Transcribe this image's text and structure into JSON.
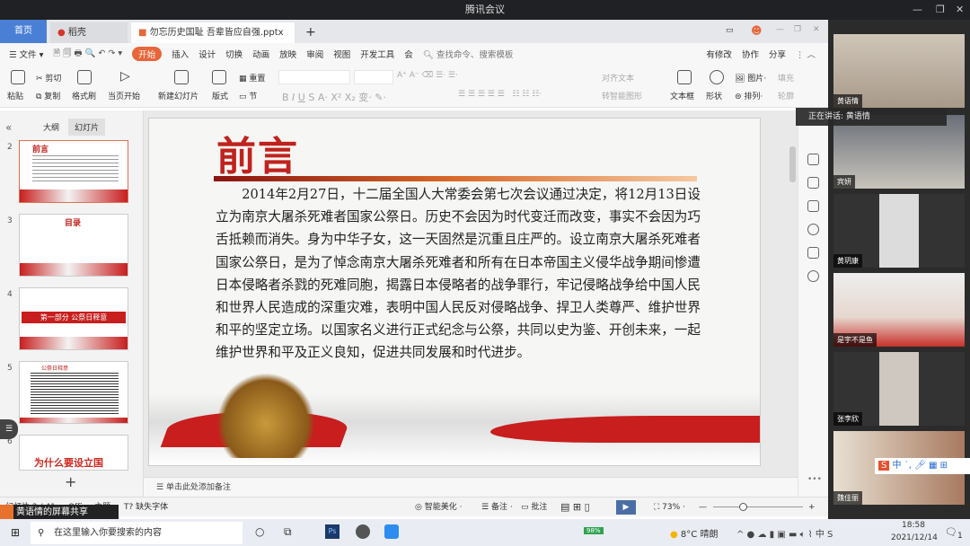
{
  "window": {
    "title": "腾讯会议"
  },
  "tabs": [
    {
      "label": "首页"
    },
    {
      "label": "稻壳"
    },
    {
      "label": "勿忘历史国耻 吾辈皆应自强.pptx"
    }
  ],
  "menu": {
    "file": "文件",
    "items": [
      "开始",
      "插入",
      "设计",
      "切换",
      "动画",
      "放映",
      "审阅",
      "视图",
      "开发工具",
      "会"
    ],
    "active": "开始",
    "search_placeholder": "查找命令、搜索模板",
    "right": [
      "有修改",
      "协作",
      "分享"
    ]
  },
  "ribbon": {
    "paste": "粘贴",
    "cut": "剪切",
    "copy": "复制",
    "format_painter": "格式刷",
    "play_from_current": "当页开始",
    "new_slide": "新建幻灯片",
    "layout": "版式",
    "section": "节",
    "reset": "重置",
    "align_text": "对齐文本",
    "smart_shape": "转智能图形",
    "textbox": "文本框",
    "shape": "形状",
    "picture": "图片",
    "arrange": "排列",
    "fill": "填充",
    "outline": "轮廓"
  },
  "left_panel": {
    "tabs": [
      "大纲",
      "幻灯片"
    ],
    "active_tab": "幻灯片",
    "slides": [
      {
        "num": "2",
        "title": "前言"
      },
      {
        "num": "3",
        "title": "目录"
      },
      {
        "num": "4",
        "title": "第一部分 公祭日释意"
      },
      {
        "num": "5",
        "title": "公祭日释意"
      },
      {
        "num": "6",
        "title": "为什么要设立国"
      }
    ],
    "add": "+"
  },
  "slide": {
    "title": "前言",
    "body": "2014年2月27日，十二届全国人大常委会第七次会议通过决定，将12月13日设立为南京大屠杀死难者国家公祭日。历史不会因为时代变迁而改变，事实不会因为巧舌抵赖而消失。身为中华子女，这一天固然是沉重且庄严的。设立南京大屠杀死难者国家公祭日，是为了悼念南京大屠杀死难者和所有在日本帝国主义侵华战争期间惨遭日本侵略者杀戮的死难同胞，揭露日本侵略者的战争罪行，牢记侵略战争给中国人民和世界人民造成的深重灾难，表明中国人民反对侵略战争、捍卫人类尊严、维护世界和平的坚定立场。以国家名义进行正式纪念与公祭，共同以史为鉴、开创未来，一起维护世界和平及正义良知，促进共同发展和时代进步。"
  },
  "notes_placeholder": "单击此处添加备注",
  "status": {
    "slide_count": "幻灯片 2 / 41",
    "theme": "Office 主题",
    "missing_font": "缺失字体",
    "beautify": "智能美化",
    "notes": "备注",
    "comment": "批注",
    "zoom": "73%",
    "zoom_level": 0.73
  },
  "screen_share": "黄语情的屏幕共享",
  "meeting": {
    "speaking": "正在讲话: 黄语情",
    "participants": [
      "黄语情",
      "宾妍",
      "黄玥康",
      "是宇不是鱼",
      "张李欣",
      "魏佳丽"
    ]
  },
  "ime": {
    "label": "中"
  },
  "taskbar": {
    "search_placeholder": "在这里输入你要搜索的内容",
    "battery": "98%",
    "weather": "8°C 晴朗",
    "time": "18:58",
    "date": "2021/12/14",
    "notifications": "1"
  },
  "colors": {
    "accent": "#e8663a",
    "home_tab": "#4a7fd6",
    "slide_red": "#c0221d"
  }
}
